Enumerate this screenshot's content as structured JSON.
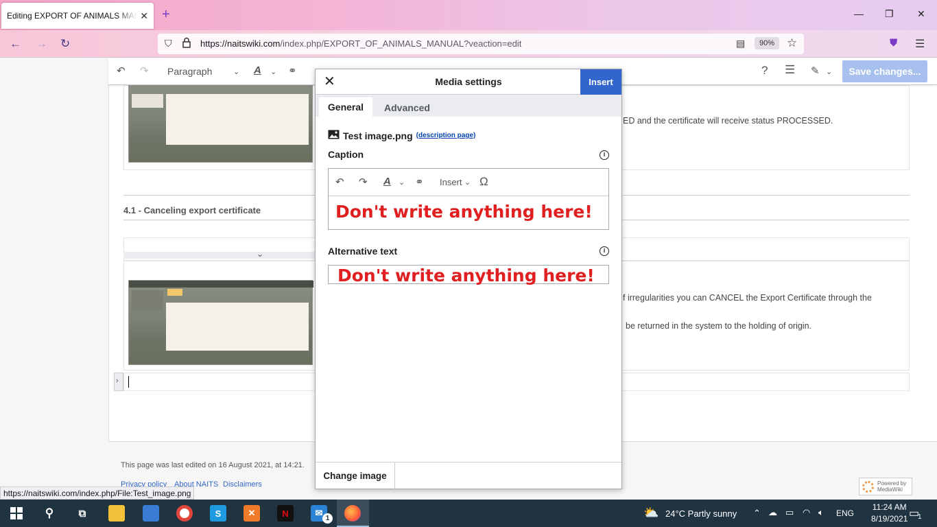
{
  "browser": {
    "tab_title": "Editing EXPORT OF ANIMALS MANUAL",
    "url_host": "https://naitswiki.com",
    "url_path": "/index.php/EXPORT_OF_ANIMALS_MANUAL?veaction=edit",
    "zoom": "90%",
    "status_url": "https://naitswiki.com/index.php/File:Test_image.png"
  },
  "editor_toolbar": {
    "paragraph_label": "Paragraph",
    "save_label": "Save changes..."
  },
  "document": {
    "text_line1": "ED and the certificate will receive status PROCESSED.",
    "heading": "4.1 - Canceling export certificate",
    "text_line2": "f irregularities you can CANCEL the Export Certificate through the",
    "text_line3": "be returned in the system to the holding of origin."
  },
  "dialog": {
    "title": "Media settings",
    "insert_label": "Insert",
    "tabs": [
      "General",
      "Advanced"
    ],
    "file_name": "Test image.png",
    "description_link": "(description page)",
    "caption_label": "Caption",
    "caption_insert_menu": "Insert",
    "caption_value": "Don't write anything here!",
    "alt_label": "Alternative text",
    "alt_value": "Don't write anything here!",
    "change_image_label": "Change image"
  },
  "footer": {
    "last_edited": "This page was last edited on 16 August 2021, at 14:21.",
    "links": [
      "Privacy policy",
      "About NAITS",
      "Disclaimers"
    ],
    "powered_by": "Powered by MediaWiki"
  },
  "taskbar": {
    "weather": "24°C  Partly sunny",
    "language": "ENG",
    "time": "11:24 AM",
    "date": "8/19/2021",
    "mail_badge": "1",
    "notif_badge": "1"
  },
  "colors": {
    "accent": "#3366cc",
    "save_disabled": "#a8c0ee",
    "warning_red": "#e02020",
    "taskbar": "#1f3340"
  }
}
